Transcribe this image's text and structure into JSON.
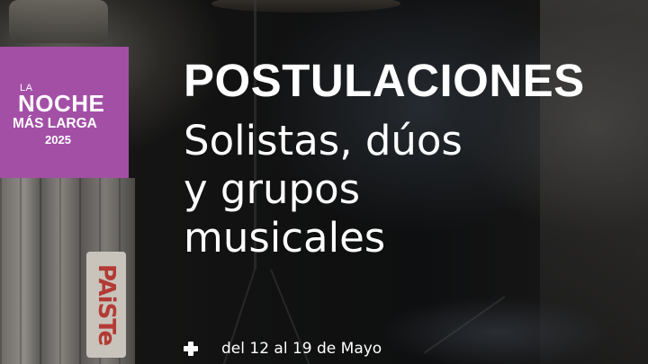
{
  "logo": {
    "la": "LA",
    "noche": "NOCHE",
    "mas_larga": "MÁS LARGA",
    "year": "2025",
    "background_color": "#a34fa6"
  },
  "heading": {
    "title": "POSTULACIONES",
    "subtitle_lines": [
      "Solistas, dúos",
      "y grupos",
      "musicales"
    ]
  },
  "dates": {
    "icon": "plus-icon",
    "text": "del 12 al 19 de Mayo"
  },
  "background": {
    "sticker_text": "PAiSTe"
  }
}
